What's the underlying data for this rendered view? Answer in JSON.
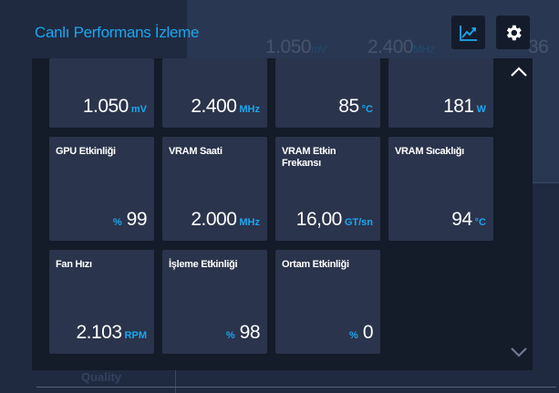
{
  "overlay": {
    "title": "Canlı Performans İzleme",
    "buttons": {
      "graph_icon": "chart-line-icon",
      "settings_icon": "gear-icon"
    },
    "colors": {
      "accent": "#1aa7f0",
      "tile_bg": "#2a344c",
      "panel_bg": "#141b29"
    }
  },
  "tiles_top": [
    {
      "value": "1.050",
      "unit": "mV"
    },
    {
      "value": "2.400",
      "unit": "MHz"
    },
    {
      "value": "85",
      "unit": "°C"
    },
    {
      "value": "181",
      "unit": "W"
    }
  ],
  "tiles": [
    {
      "label": "GPU Etkinliği",
      "prefix": "%",
      "value": "99",
      "unit": ""
    },
    {
      "label": "VRAM Saati",
      "prefix": "",
      "value": "2.000",
      "unit": "MHz"
    },
    {
      "label": "VRAM Etkin Frekansı",
      "prefix": "",
      "value": "16,00",
      "unit": "GT/sn"
    },
    {
      "label": "VRAM Sıcaklığı",
      "prefix": "",
      "value": "94",
      "unit": "°C"
    },
    {
      "label": "Fan Hızı",
      "prefix": "",
      "value": "2.103",
      "unit": "RPM"
    },
    {
      "label": "İşleme Etkinliği",
      "prefix": "%",
      "value": "98",
      "unit": ""
    },
    {
      "label": "Ortam Etkinliği",
      "prefix": "%",
      "value": "0",
      "unit": ""
    }
  ],
  "background": {
    "ghost_values": [
      {
        "value": "1.050",
        "unit": "mV"
      },
      {
        "value": "2.400",
        "unit": "MHz"
      },
      {
        "value": "36",
        "unit": ""
      }
    ],
    "quality_label": "Quality"
  }
}
